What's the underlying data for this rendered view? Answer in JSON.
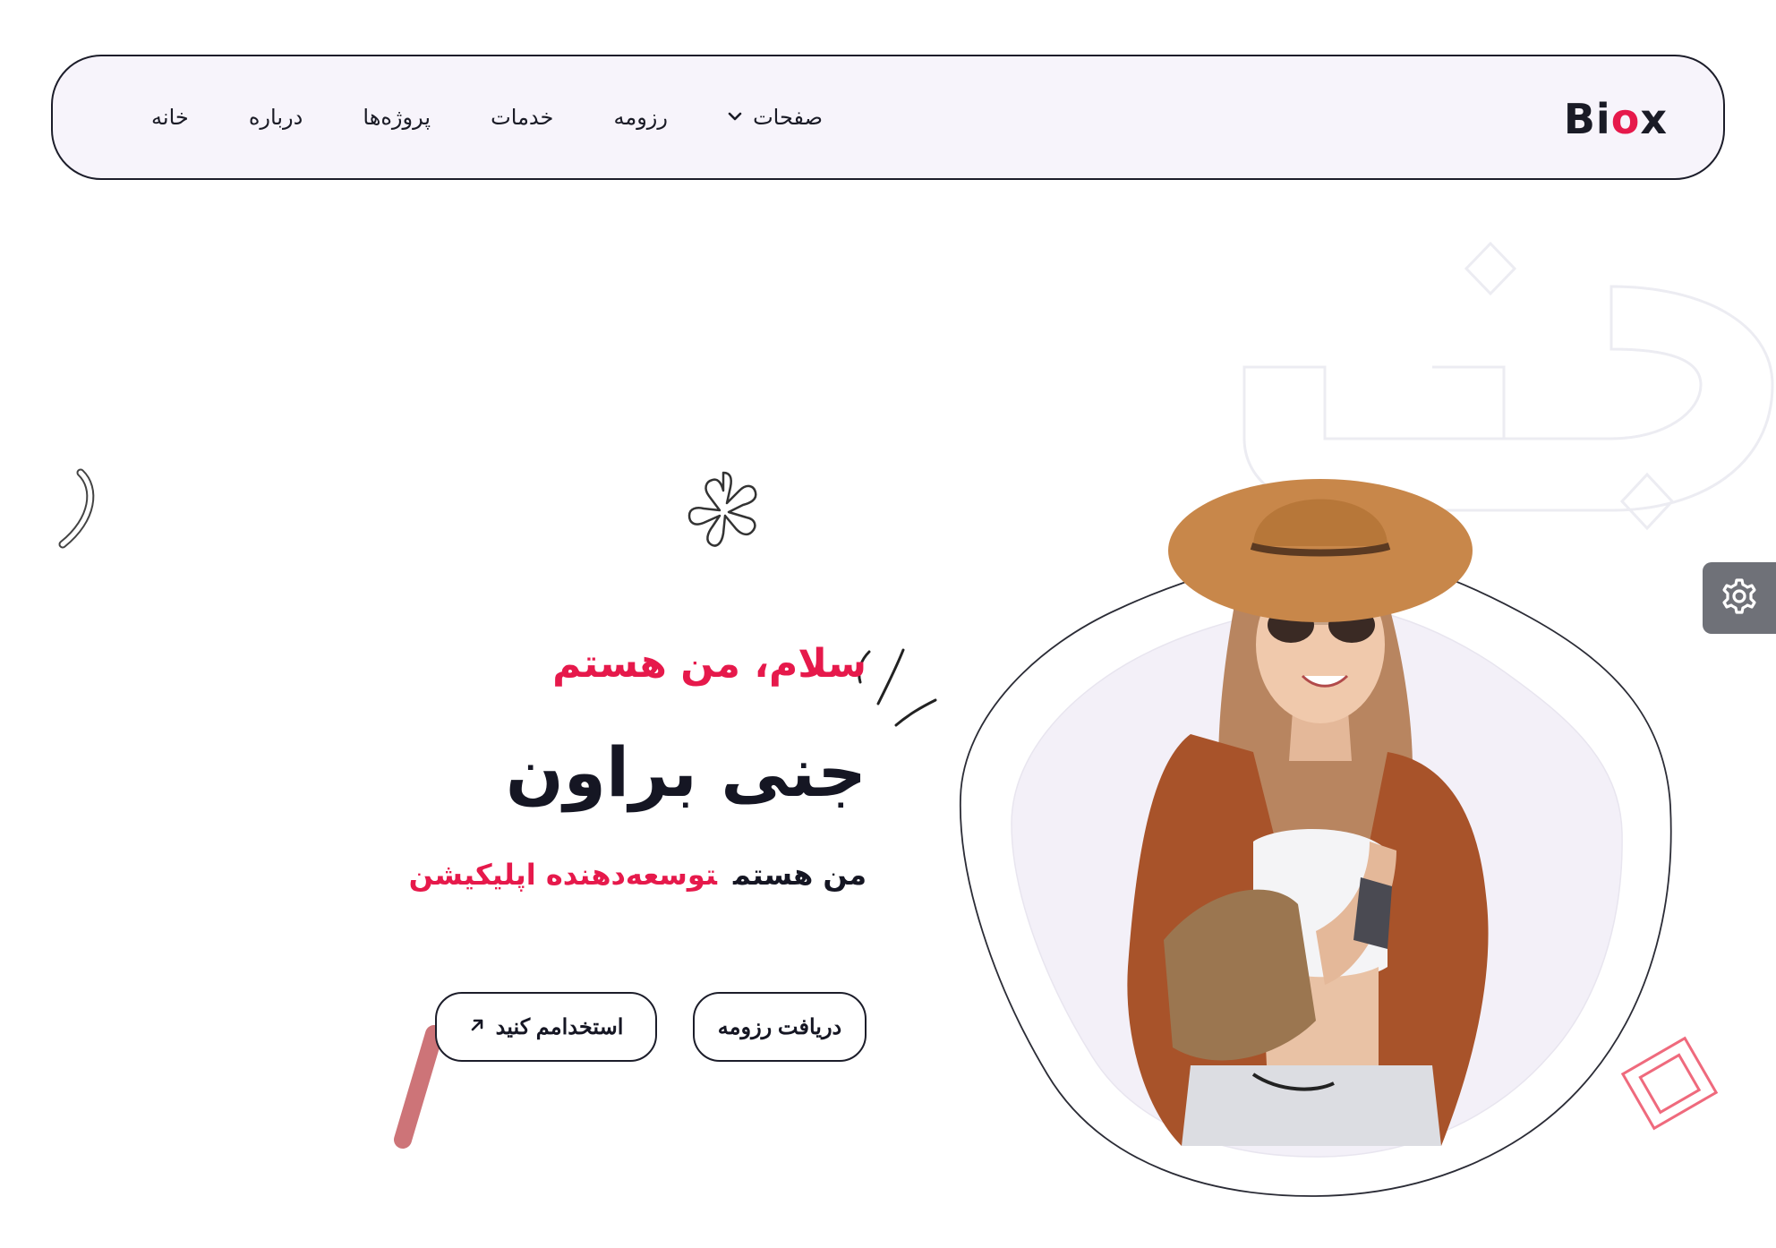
{
  "header": {
    "logo_main": "Bi",
    "logo_accent": "o",
    "logo_end": "x",
    "nav": [
      {
        "label": "خانه"
      },
      {
        "label": "درباره"
      },
      {
        "label": "پروژه‌ها"
      },
      {
        "label": "خدمات"
      },
      {
        "label": "رزومه"
      },
      {
        "label": "صفحات"
      }
    ]
  },
  "hero": {
    "greeting": "سلام، من هستم",
    "name": "جنی براون",
    "role_prefix": "من هستم",
    "role": "توسعه‌دهنده اپلیکیشن",
    "download_resume": "دریافت رزومه",
    "hire_me": "استخدامم کنید"
  },
  "colors": {
    "accent": "#e6194b",
    "dark": "#151623",
    "nav_bg": "#f7f4fb",
    "settings_bg": "#6f7178"
  },
  "icons": {
    "settings": "gear-icon",
    "hire_arrow": "arrow-up-right-icon",
    "dropdown": "chevron-down-icon"
  }
}
